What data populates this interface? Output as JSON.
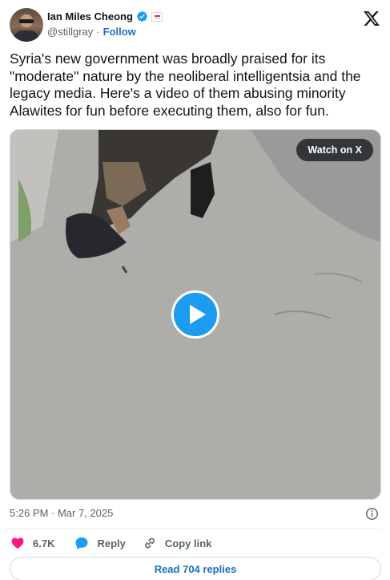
{
  "author": {
    "display_name": "Ian Miles Cheong",
    "handle": "@stillgray",
    "separator": "·",
    "follow_label": "Follow"
  },
  "tweet": {
    "text": "Syria's new government was broadly praised for its \"moderate\" nature by the neoliberal intelligentsia and the legacy media. Here's a video of them abusing minority Alawites for fun before executing them, also for fun."
  },
  "media": {
    "watch_label": "Watch on X",
    "play_icon": "play-icon"
  },
  "meta": {
    "timestamp": "5:26 PM · Mar 7, 2025"
  },
  "actions": {
    "like_count": "6.7K",
    "reply_label": "Reply",
    "copy_label": "Copy link"
  },
  "replies": {
    "label": "Read 704 replies"
  },
  "colors": {
    "accent": "#1d9bf0",
    "link": "#1d6fc2",
    "like": "#f91880",
    "text": "#0f1419",
    "muted": "#536471"
  }
}
